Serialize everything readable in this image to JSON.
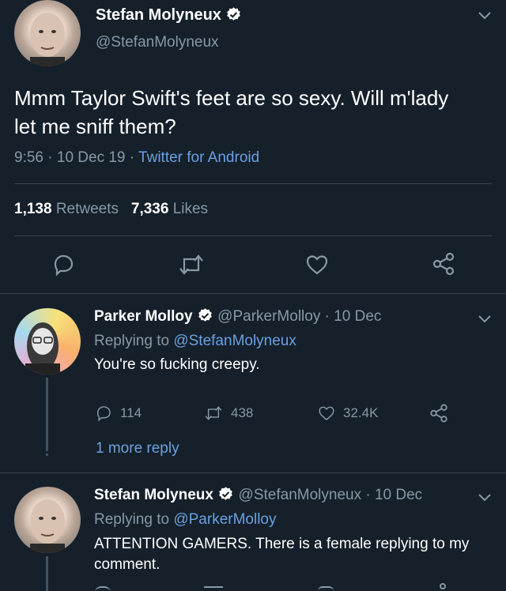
{
  "main_tweet": {
    "author_name": "Stefan Molyneux",
    "author_handle": "@StefanMolyneux",
    "text_line1": "Mmm Taylor Swift's feet are so sexy. Will m'lady",
    "text_line2": "let me sniff them?",
    "time": "9:56",
    "date": "10 Dec 19",
    "source": "Twitter for Android",
    "retweets_count": "1,138",
    "retweets_label": "Retweets",
    "likes_count": "7,336",
    "likes_label": "Likes",
    "sep": "·"
  },
  "reply1": {
    "author_name": "Parker Molloy",
    "handle_date": "@ParkerMolloy · 10 Dec",
    "replying_prefix": "Replying to",
    "replying_to": "@StefanMolyneux",
    "text": "You're so fucking creepy.",
    "reply_count": "114",
    "retweet_count": "438",
    "like_count": "32.4K",
    "more_replies": "1 more reply"
  },
  "reply2": {
    "author_name": "Stefan Molyneux",
    "handle_date": "@StefanMolyneux · 10 Dec",
    "replying_prefix": "Replying to",
    "replying_to": "@ParkerMolloy",
    "text_line1": "ATTENTION GAMERS. There is a female replying to my",
    "text_line2": "comment."
  },
  "icons": {
    "verified": "verified-badge-icon",
    "chevron": "chevron-down-icon",
    "reply": "reply-icon",
    "retweet": "retweet-icon",
    "like": "heart-icon",
    "share": "share-icon"
  },
  "colors": {
    "background": "#15202b",
    "muted": "#8899a6",
    "link": "#6aa1e0",
    "divider": "#38444d"
  }
}
